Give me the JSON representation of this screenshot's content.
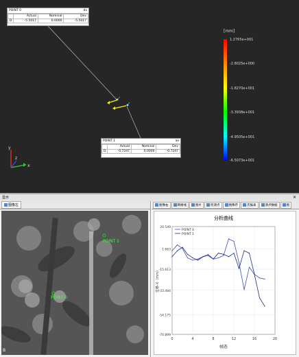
{
  "colors": {
    "accent": "#00ffff",
    "arrow": "#ffee00",
    "series_0": "#3a4fb8",
    "series_1": "#1c2a80"
  },
  "callouts": [
    {
      "name": "POINT 0",
      "flag": "dx",
      "headers": [
        "Actual",
        "Nominal",
        "Dev"
      ],
      "row": {
        "axis": "D",
        "actual": "-5.5017",
        "nominal": "0.0000",
        "dev": "-5.5017"
      }
    },
    {
      "name": "POINT 1",
      "flag": "ax",
      "headers": [
        "Actual",
        "Nominal",
        "Dev"
      ],
      "row": {
        "axis": "D",
        "actual": "-0.7247",
        "nominal": "0.0000",
        "dev": "-0.7247"
      }
    }
  ],
  "legend": {
    "unit": "[mm]",
    "ticks": [
      "1.2765e+001",
      "-2.8025e+000",
      "-1.8270e+001",
      "-3.3938e+001",
      "-4.9505e+001",
      "-6.5073e+001"
    ]
  },
  "triad": {
    "y": "y",
    "z": "z",
    "x": "x"
  },
  "mid_bar": {
    "label": "显示",
    "close": "✕"
  },
  "camera_panel": {
    "tab_label": "图像左",
    "side_mark": "B"
  },
  "chart_tabs": [
    "图像右",
    "网格线",
    "图片",
    "检测点",
    "图像存",
    "次报表",
    "测点数据",
    "图"
  ],
  "chart_data": {
    "type": "line",
    "title": "分析曲线",
    "xlabel": "帧态",
    "ylabel": "位移-X（mm）",
    "xlim": [
      0,
      20
    ],
    "ylim": [
      -70.899,
      20.549
    ],
    "x_ticks": [
      "0",
      "4",
      "8",
      "12",
      "16",
      "20"
    ],
    "y_ticks": [
      "20.549",
      "1.663",
      "-15.613",
      "-33.484",
      "-54.175",
      "-70.899"
    ],
    "series": [
      {
        "name": "POINT 0",
        "x": [
          0,
          1,
          2,
          3,
          4,
          5,
          6,
          7,
          8,
          9,
          10,
          11,
          12,
          13,
          14,
          15,
          16,
          17,
          18
        ],
        "y": [
          0,
          5,
          2,
          -6,
          -8,
          -7,
          -5,
          -3,
          -7,
          -6,
          -4,
          10,
          8,
          -10,
          -33,
          -14,
          -20,
          -23,
          -24
        ]
      },
      {
        "name": "POINT 1",
        "x": [
          0,
          1,
          2,
          3,
          4,
          5,
          6,
          7,
          8,
          9,
          10,
          11,
          12,
          13,
          14,
          15,
          16,
          17,
          18
        ],
        "y": [
          -5,
          0,
          3,
          -3,
          -6,
          -8,
          -5,
          -4,
          -7,
          -2,
          -3,
          -5,
          -2,
          -15,
          0,
          -2,
          -20,
          -40,
          -47
        ]
      }
    ]
  }
}
